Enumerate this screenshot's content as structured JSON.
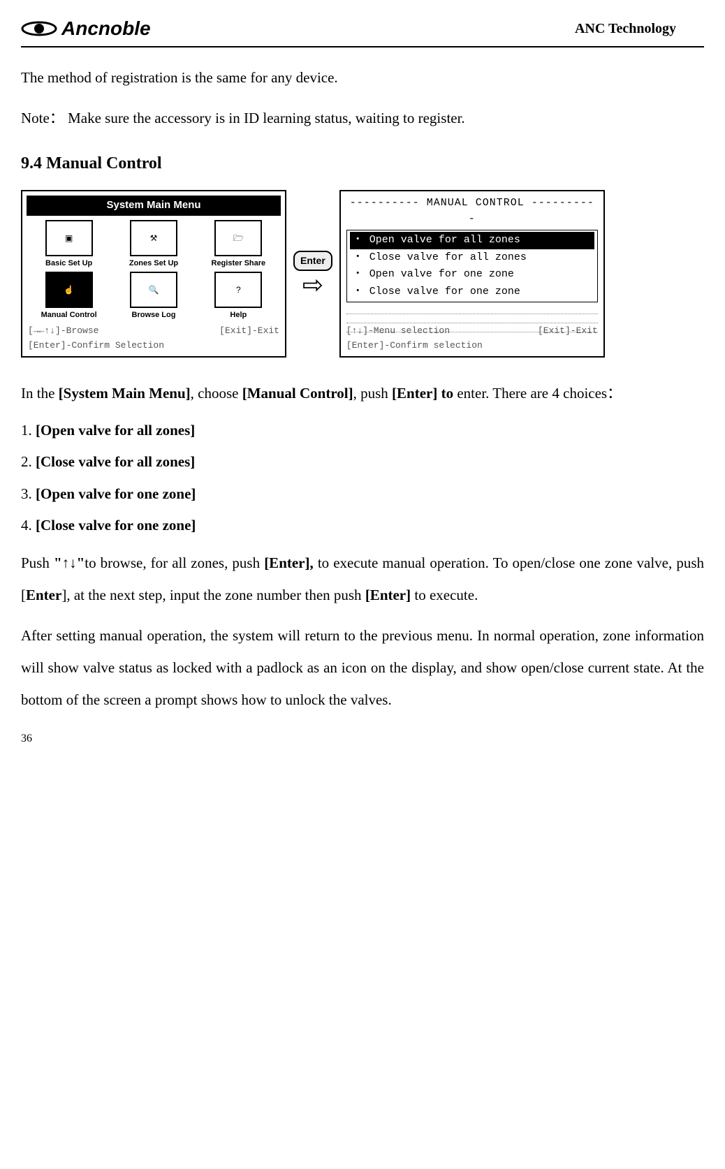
{
  "header": {
    "logo_text": "Ancnoble",
    "right_title": "ANC Technology"
  },
  "intro": {
    "p1": "The method of registration is the same for any device.",
    "p2_a": "Note：",
    "p2_b": "Make sure the accessory is in ID learning status, waiting to register."
  },
  "section_head": "9.4 Manual Control",
  "screen1": {
    "title": "System Main Menu",
    "icons": [
      {
        "label": "Basic Set Up",
        "glyph": "▣"
      },
      {
        "label": "Zones Set Up",
        "glyph": "⚒"
      },
      {
        "label": "Register Share",
        "glyph": "🗁"
      },
      {
        "label": "Manual Control",
        "glyph": "☝",
        "selected": true
      },
      {
        "label": "Browse Log",
        "glyph": "🔍"
      },
      {
        "label": "Help",
        "glyph": "?"
      }
    ],
    "footer_browse": "[→←↑↓]-Browse",
    "footer_exit": "[Exit]-Exit",
    "footer_confirm": "[Enter]-Confirm Selection"
  },
  "arrow": {
    "enter_label": "Enter"
  },
  "screen2": {
    "title": "---------- MANUAL CONTROL ----------",
    "items": [
      "Open valve for all zones",
      "Close valve for all zones",
      "Open valve for one zone",
      "Close valve for one zone"
    ],
    "footer_menu": "[↑↓]-Menu selection",
    "footer_exit": "[Exit]-Exit",
    "footer_confirm": "[Enter]-Confirm selection"
  },
  "after_fig": {
    "lead_a": "In the ",
    "lead_b": "[System Main Menu]",
    "lead_c": ", choose ",
    "lead_d": "[Manual Control]",
    "lead_e": ", push ",
    "lead_f": "[Enter] to ",
    "lead_g": "enter. There are 4 choices："
  },
  "choices": [
    {
      "n": "1. ",
      "b": "[Open valve for all zones]"
    },
    {
      "n": "2. ",
      "b": "[Close valve for all zones]"
    },
    {
      "n": "3. ",
      "b": "[Open valve for one zone]"
    },
    {
      "n": "4. ",
      "b": "[Close valve for one zone]"
    }
  ],
  "tail": {
    "t1_a": "Push ",
    "t1_b": "\"↑↓\"",
    "t1_c": "to browse, for all zones, push ",
    "t1_d": "[Enter], ",
    "t1_e": "to execute manual operation. To open/close one zone valve, push [",
    "t1_f": "Enter",
    "t1_g": "], at the next step, input the zone number then push ",
    "t1_h": "[Enter]",
    "t1_i": " to execute.",
    "t2": "After setting manual operation, the system will return to the previous menu. In normal operation, zone information will show valve status as locked with a padlock as an icon on the display, and show open/close current state. At the bottom of the screen a prompt shows how to unlock the valves."
  },
  "page_number": "36"
}
